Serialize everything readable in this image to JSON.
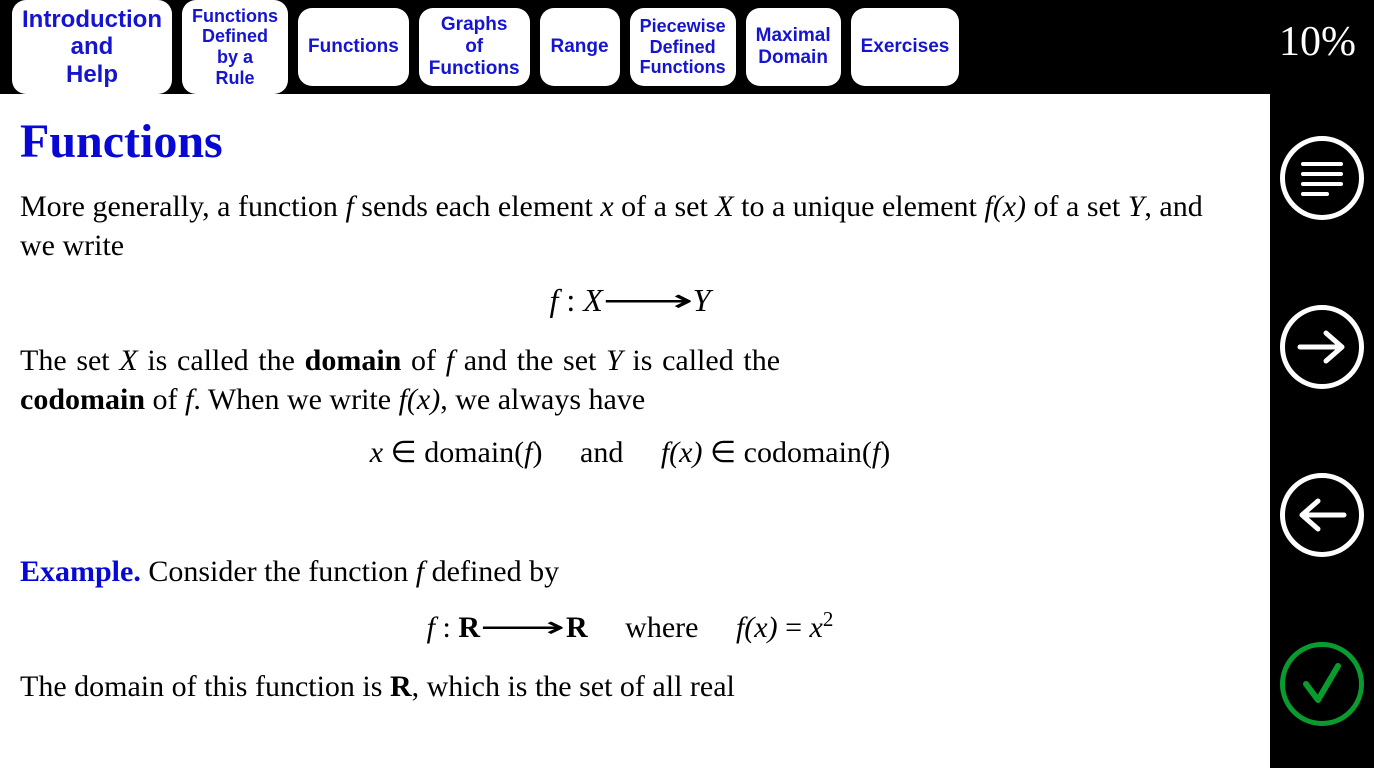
{
  "progress_text": "10%",
  "tabs": [
    "Introduction\nand\nHelp",
    "Functions\nDefined\nby a\nRule",
    "Functions",
    "Graphs\nof\nFunctions",
    "Range",
    "Piecewise\nDefined\nFunctions",
    "Maximal\nDomain",
    "Exercises"
  ],
  "page": {
    "title": "Functions",
    "para1_a": "More generally, a function ",
    "para1_b": " sends each element ",
    "para1_c": " of a set ",
    "para1_d": " to a unique element ",
    "para1_e": " of a set ",
    "para1_f": ", and we write",
    "f_sym": "f",
    "x_sym": "x",
    "X_sym": "X",
    "Y_sym": "Y",
    "fx": "f(x)",
    "map_colon": " : ",
    "arrow": "→",
    "para2_a": "The set ",
    "para2_b": " is called the ",
    "domain_word": "domain",
    "para2_c": " of ",
    "para2_d": " and the set ",
    "para2_e": " is called the ",
    "codomain_word": "codomain",
    "para2_f": " of ",
    "para2_g": ". When we write ",
    "para2_h": ", we always have",
    "elem": " ∈ ",
    "domain_f": "domain(",
    "codomain_f": "codomain(",
    "close_paren": ")",
    "and_word": "and",
    "example_label": "Example.",
    "example_text": " Consider the function ",
    "example_tail": " defined by",
    "R_sym": "R",
    "where_word": "where",
    "eq": " = ",
    "sq": "2",
    "para3_a": "The domain of this function is ",
    "para3_b": ", which is the set of all real"
  },
  "icons": {
    "menu": "menu-icon",
    "next": "arrow-right-icon",
    "prev": "arrow-left-icon",
    "check": "check-icon"
  }
}
